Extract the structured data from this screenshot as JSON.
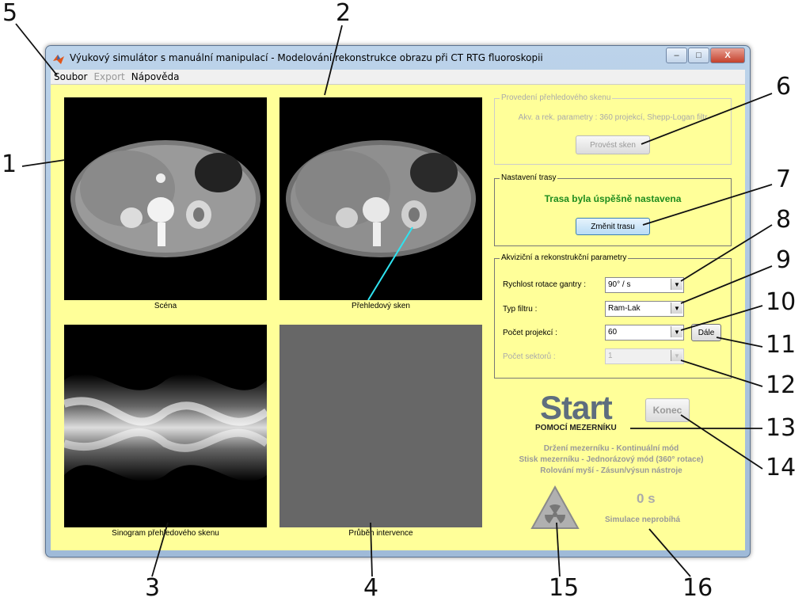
{
  "callouts": {
    "c1": "1",
    "c2": "2",
    "c3": "3",
    "c4": "4",
    "c5": "5",
    "c6": "6",
    "c7": "7",
    "c8": "8",
    "c9": "9",
    "c10": "10",
    "c11": "11",
    "c12": "12",
    "c13": "13",
    "c14": "14",
    "c15": "15",
    "c16": "16"
  },
  "window": {
    "title": "Výukový simulátor s manuální manipulací - Modelování rekonstrukce obrazu při CT RTG fluoroskopii",
    "minimize": "–",
    "maximize": "□",
    "close": "X"
  },
  "menu": {
    "soubor": "Soubor",
    "export": "Export",
    "napoveda": "Nápověda"
  },
  "panels": {
    "scene": "Scéna",
    "overview": "Přehledový sken",
    "sinogram": "Sinogram přehledového skenu",
    "intervention": "Průběh intervence"
  },
  "scan_group": {
    "legend": "Provedení přehledového skenu",
    "params": "Akv. a rek. parametry : 360 projekcí, Shepp-Logan filtr",
    "button": "Provést sken"
  },
  "route_group": {
    "legend": "Nastavení trasy",
    "status": "Trasa byla úspěšně nastavena",
    "button": "Změnit trasu",
    "status_color": "#1e8c1e"
  },
  "acq_group": {
    "legend": "Akviziční a rekonstrukční parametry",
    "rotation_label": "Rychlost rotace gantry :",
    "rotation_value": "90° / s",
    "filter_label": "Typ filtru :",
    "filter_value": "Ram-Lak",
    "projections_label": "Počet projekcí :",
    "projections_value": "60",
    "next_button": "Dále",
    "sectors_label": "Počet sektorů :",
    "sectors_value": "1"
  },
  "start": {
    "big": "Start",
    "sub": "POMOCÍ MEZERNÍKU",
    "end_button": "Konec"
  },
  "info": {
    "line1": "Držení mezerníku - Kontinuální mód",
    "line2": "Stisk mezerníku - Jednorázový mód (360° rotace)",
    "line3": "Rolování myší - Zásun/výsun nástroje"
  },
  "sim": {
    "time": "0 s",
    "status": "Simulace neprobíhá"
  },
  "icons": {
    "radiation": "radiation-icon",
    "app": "matlab-icon"
  }
}
